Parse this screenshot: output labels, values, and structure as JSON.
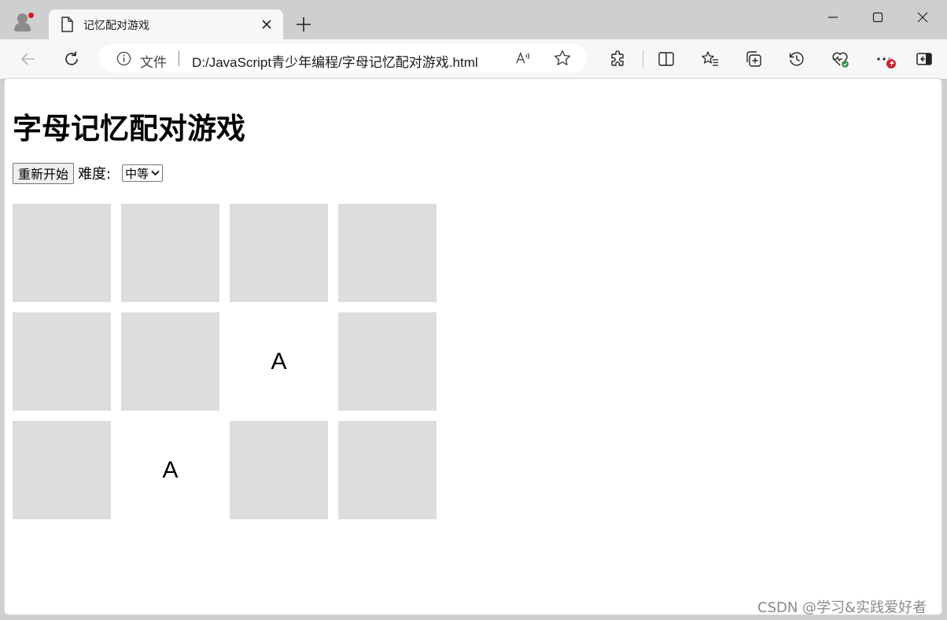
{
  "browser": {
    "tab_title": "记忆配对游戏",
    "address_prefix": "文件",
    "url": "D:/JavaScript青少年编程/字母记忆配对游戏.html"
  },
  "page": {
    "title": "字母记忆配对游戏",
    "restart_label": "重新开始",
    "difficulty_label": "难度:",
    "difficulty_selected": "中等"
  },
  "cards": [
    {
      "letter": "",
      "flipped": false
    },
    {
      "letter": "",
      "flipped": false
    },
    {
      "letter": "",
      "flipped": false
    },
    {
      "letter": "",
      "flipped": false
    },
    {
      "letter": "",
      "flipped": false
    },
    {
      "letter": "",
      "flipped": false
    },
    {
      "letter": "A",
      "flipped": true
    },
    {
      "letter": "",
      "flipped": false
    },
    {
      "letter": "",
      "flipped": false
    },
    {
      "letter": "A",
      "flipped": true
    },
    {
      "letter": "",
      "flipped": false
    },
    {
      "letter": "",
      "flipped": false
    }
  ],
  "watermark": "CSDN @学习&实践爱好者",
  "colors": {
    "card_back": "#dddddd",
    "card_face": "#ffffff",
    "notification_badge": "#c9252d"
  }
}
